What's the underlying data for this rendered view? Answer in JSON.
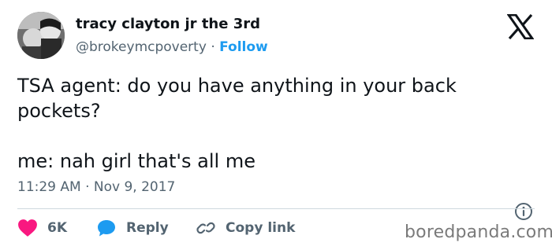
{
  "author": {
    "name": "tracy clayton jr the 3rd",
    "handle": "@brokeymcpoverty",
    "separator": "·",
    "follow_label": "Follow"
  },
  "tweet": {
    "lines": [
      "TSA agent: do you have anything in your back pockets?",
      "me: nah girl that's all me"
    ],
    "timestamp": "11:29 AM · Nov 9, 2017"
  },
  "actions": {
    "like_count": "6K",
    "reply_label": "Reply",
    "copy_link_label": "Copy link"
  },
  "watermark": "boredpanda.com",
  "colors": {
    "like": "#f91880",
    "reply": "#1d9bf0",
    "follow": "#1d9bf0",
    "muted": "#536471",
    "text": "#0f1419"
  },
  "icons": [
    "x-logo-icon",
    "info-icon",
    "heart-icon",
    "reply-bubble-icon",
    "link-icon"
  ]
}
